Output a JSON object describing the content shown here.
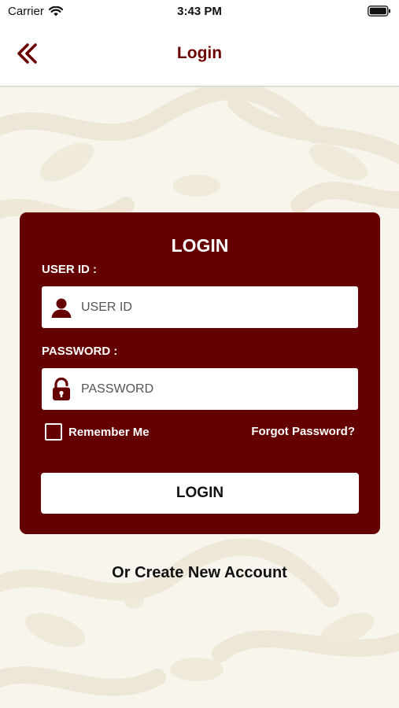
{
  "status_bar": {
    "carrier": "Carrier",
    "time": "3:43 PM"
  },
  "nav": {
    "title": "Login",
    "back_icon": "double-chevron-left-icon"
  },
  "colors": {
    "brand": "#650000",
    "nav_title": "#6b0000",
    "background": "#f8f5ec"
  },
  "login_card": {
    "title": "LOGIN",
    "user_id": {
      "label": "USER ID :",
      "placeholder": "USER ID",
      "value": "",
      "icon": "user-icon"
    },
    "password": {
      "label": "PASSWORD :",
      "placeholder": "PASSWORD",
      "value": "",
      "icon": "unlocked-padlock-icon"
    },
    "remember_me": {
      "label": "Remember Me",
      "checked": false
    },
    "forgot_password": "Forgot Password?",
    "submit_label": "LOGIN"
  },
  "create_account": "Or Create New Account"
}
